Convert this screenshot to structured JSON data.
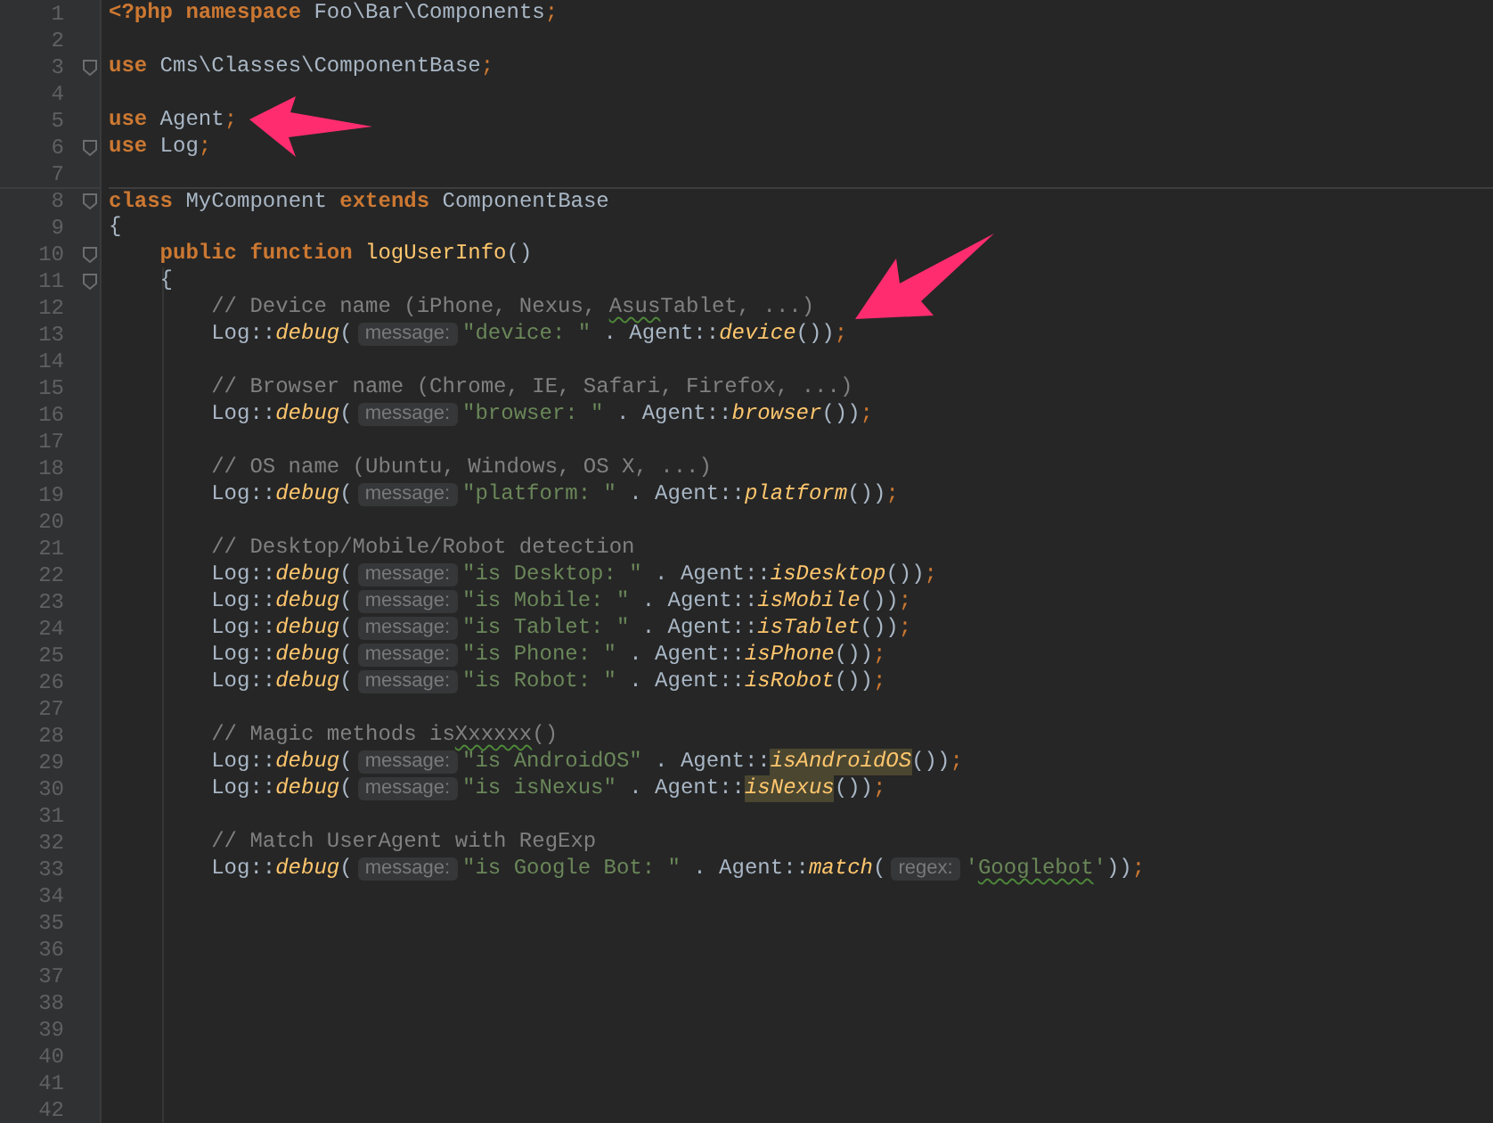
{
  "editor": {
    "lines": [
      {
        "number": "1",
        "fold": false,
        "kind": "top",
        "tokens": [
          {
            "kind": "keyword",
            "text": "<?php namespace"
          },
          {
            "kind": "plain",
            "text": " Foo\\Bar\\Components"
          },
          {
            "kind": "semicolon",
            "text": ";"
          }
        ]
      },
      {
        "number": "2",
        "fold": false,
        "kind": "blank"
      },
      {
        "number": "3",
        "fold": true,
        "kind": "top",
        "tokens": [
          {
            "kind": "keyword",
            "text": "use"
          },
          {
            "kind": "plain",
            "text": " Cms\\Classes\\ComponentBase"
          },
          {
            "kind": "semicolon",
            "text": ";"
          }
        ]
      },
      {
        "number": "4",
        "fold": false,
        "kind": "blank"
      },
      {
        "number": "5",
        "fold": false,
        "kind": "top",
        "tokens": [
          {
            "kind": "keyword",
            "text": "use"
          },
          {
            "kind": "plain",
            "text": " Agent"
          },
          {
            "kind": "semicolon",
            "text": ";"
          }
        ]
      },
      {
        "number": "6",
        "fold": true,
        "kind": "top",
        "tokens": [
          {
            "kind": "keyword",
            "text": "use"
          },
          {
            "kind": "plain",
            "text": " Log"
          },
          {
            "kind": "semicolon",
            "text": ";"
          }
        ]
      },
      {
        "number": "7",
        "fold": false,
        "kind": "blank"
      },
      {
        "number": "8",
        "fold": true,
        "divider": true,
        "kind": "top",
        "tokens": [
          {
            "kind": "keyword",
            "text": "class"
          },
          {
            "kind": "plain",
            "text": " MyComponent "
          },
          {
            "kind": "keyword",
            "text": "extends"
          },
          {
            "kind": "plain",
            "text": " ComponentBase"
          }
        ]
      },
      {
        "number": "9",
        "fold": false,
        "kind": "top",
        "tokens": [
          {
            "kind": "plain",
            "text": "{"
          }
        ]
      },
      {
        "number": "10",
        "fold": true,
        "kind": "member",
        "tokens": [
          {
            "kind": "keyword",
            "text": "public function"
          },
          {
            "kind": "declaration",
            "text": " logUserInfo"
          },
          {
            "kind": "plain",
            "text": "()"
          }
        ]
      },
      {
        "number": "11",
        "fold": true,
        "kind": "member",
        "tokens": [
          {
            "kind": "plain",
            "text": "{"
          }
        ]
      },
      {
        "number": "12",
        "fold": false,
        "kind": "statement",
        "tokens": [
          {
            "kind": "comment",
            "text": "// Device name (iPhone, Nexus, "
          },
          {
            "kind": "comment-typo",
            "text": "Asus"
          },
          {
            "kind": "comment",
            "text": "Tablet, ...)"
          }
        ]
      },
      {
        "number": "13",
        "fold": false,
        "kind": "statement",
        "tokens": [
          {
            "kind": "plain",
            "text": "Log::"
          },
          {
            "kind": "call",
            "text": "debug"
          },
          {
            "kind": "plain",
            "text": "("
          },
          {
            "kind": "hint",
            "text": "message:"
          },
          {
            "kind": "string",
            "text": "\"device: \""
          },
          {
            "kind": "plain",
            "text": " . Agent::"
          },
          {
            "kind": "call",
            "text": "device"
          },
          {
            "kind": "plain",
            "text": "())"
          },
          {
            "kind": "semicolon",
            "text": ";"
          }
        ]
      },
      {
        "number": "14",
        "fold": false,
        "kind": "blank"
      },
      {
        "number": "15",
        "fold": false,
        "kind": "statement",
        "tokens": [
          {
            "kind": "comment",
            "text": "// Browser name (Chrome, IE, Safari, Firefox, ...)"
          }
        ]
      },
      {
        "number": "16",
        "fold": false,
        "kind": "statement",
        "tokens": [
          {
            "kind": "plain",
            "text": "Log::"
          },
          {
            "kind": "call",
            "text": "debug"
          },
          {
            "kind": "plain",
            "text": "("
          },
          {
            "kind": "hint",
            "text": "message:"
          },
          {
            "kind": "string",
            "text": "\"browser: \""
          },
          {
            "kind": "plain",
            "text": " . Agent::"
          },
          {
            "kind": "call",
            "text": "browser"
          },
          {
            "kind": "plain",
            "text": "())"
          },
          {
            "kind": "semicolon",
            "text": ";"
          }
        ]
      },
      {
        "number": "17",
        "fold": false,
        "kind": "blank"
      },
      {
        "number": "18",
        "fold": false,
        "kind": "statement",
        "tokens": [
          {
            "kind": "comment",
            "text": "// OS name (Ubuntu, Windows, OS X, ...)"
          }
        ]
      },
      {
        "number": "19",
        "fold": false,
        "kind": "statement",
        "tokens": [
          {
            "kind": "plain",
            "text": "Log::"
          },
          {
            "kind": "call",
            "text": "debug"
          },
          {
            "kind": "plain",
            "text": "("
          },
          {
            "kind": "hint",
            "text": "message:"
          },
          {
            "kind": "string",
            "text": "\"platform: \""
          },
          {
            "kind": "plain",
            "text": " . Agent::"
          },
          {
            "kind": "call",
            "text": "platform"
          },
          {
            "kind": "plain",
            "text": "())"
          },
          {
            "kind": "semicolon",
            "text": ";"
          }
        ]
      },
      {
        "number": "20",
        "fold": false,
        "kind": "blank"
      },
      {
        "number": "21",
        "fold": false,
        "kind": "statement",
        "tokens": [
          {
            "kind": "comment",
            "text": "// Desktop/Mobile/Robot detection"
          }
        ]
      },
      {
        "number": "22",
        "fold": false,
        "kind": "statement",
        "tokens": [
          {
            "kind": "plain",
            "text": "Log::"
          },
          {
            "kind": "call",
            "text": "debug"
          },
          {
            "kind": "plain",
            "text": "("
          },
          {
            "kind": "hint",
            "text": "message:"
          },
          {
            "kind": "string",
            "text": "\"is Desktop: \""
          },
          {
            "kind": "plain",
            "text": " . Agent::"
          },
          {
            "kind": "call",
            "text": "isDesktop"
          },
          {
            "kind": "plain",
            "text": "())"
          },
          {
            "kind": "semicolon",
            "text": ";"
          }
        ]
      },
      {
        "number": "23",
        "fold": false,
        "kind": "statement",
        "tokens": [
          {
            "kind": "plain",
            "text": "Log::"
          },
          {
            "kind": "call",
            "text": "debug"
          },
          {
            "kind": "plain",
            "text": "("
          },
          {
            "kind": "hint",
            "text": "message:"
          },
          {
            "kind": "string",
            "text": "\"is Mobile: \""
          },
          {
            "kind": "plain",
            "text": " . Agent::"
          },
          {
            "kind": "call",
            "text": "isMobile"
          },
          {
            "kind": "plain",
            "text": "())"
          },
          {
            "kind": "semicolon",
            "text": ";"
          }
        ]
      },
      {
        "number": "24",
        "fold": false,
        "kind": "statement",
        "tokens": [
          {
            "kind": "plain",
            "text": "Log::"
          },
          {
            "kind": "call",
            "text": "debug"
          },
          {
            "kind": "plain",
            "text": "("
          },
          {
            "kind": "hint",
            "text": "message:"
          },
          {
            "kind": "string",
            "text": "\"is Tablet: \""
          },
          {
            "kind": "plain",
            "text": " . Agent::"
          },
          {
            "kind": "call",
            "text": "isTablet"
          },
          {
            "kind": "plain",
            "text": "())"
          },
          {
            "kind": "semicolon",
            "text": ";"
          }
        ]
      },
      {
        "number": "25",
        "fold": false,
        "kind": "statement",
        "tokens": [
          {
            "kind": "plain",
            "text": "Log::"
          },
          {
            "kind": "call",
            "text": "debug"
          },
          {
            "kind": "plain",
            "text": "("
          },
          {
            "kind": "hint",
            "text": "message:"
          },
          {
            "kind": "string",
            "text": "\"is Phone: \""
          },
          {
            "kind": "plain",
            "text": " . Agent::"
          },
          {
            "kind": "call",
            "text": "isPhone"
          },
          {
            "kind": "plain",
            "text": "())"
          },
          {
            "kind": "semicolon",
            "text": ";"
          }
        ]
      },
      {
        "number": "26",
        "fold": false,
        "kind": "statement",
        "tokens": [
          {
            "kind": "plain",
            "text": "Log::"
          },
          {
            "kind": "call",
            "text": "debug"
          },
          {
            "kind": "plain",
            "text": "("
          },
          {
            "kind": "hint",
            "text": "message:"
          },
          {
            "kind": "string",
            "text": "\"is Robot: \""
          },
          {
            "kind": "plain",
            "text": " . Agent::"
          },
          {
            "kind": "call",
            "text": "isRobot"
          },
          {
            "kind": "plain",
            "text": "())"
          },
          {
            "kind": "semicolon",
            "text": ";"
          }
        ]
      },
      {
        "number": "27",
        "fold": false,
        "kind": "blank"
      },
      {
        "number": "28",
        "fold": false,
        "kind": "statement",
        "tokens": [
          {
            "kind": "comment",
            "text": "// Magic methods is"
          },
          {
            "kind": "comment-typo",
            "text": "Xxxxxx"
          },
          {
            "kind": "comment",
            "text": "()"
          }
        ]
      },
      {
        "number": "29",
        "fold": false,
        "kind": "statement",
        "tokens": [
          {
            "kind": "plain",
            "text": "Log::"
          },
          {
            "kind": "call",
            "text": "debug"
          },
          {
            "kind": "plain",
            "text": "("
          },
          {
            "kind": "hint",
            "text": "message:"
          },
          {
            "kind": "string",
            "text": "\"is AndroidOS\""
          },
          {
            "kind": "plain",
            "text": " . Agent::"
          },
          {
            "kind": "call-highlight",
            "text": "isAndroidOS"
          },
          {
            "kind": "plain",
            "text": "())"
          },
          {
            "kind": "semicolon",
            "text": ";"
          }
        ]
      },
      {
        "number": "30",
        "fold": false,
        "kind": "statement",
        "tokens": [
          {
            "kind": "plain",
            "text": "Log::"
          },
          {
            "kind": "call",
            "text": "debug"
          },
          {
            "kind": "plain",
            "text": "("
          },
          {
            "kind": "hint",
            "text": "message:"
          },
          {
            "kind": "string",
            "text": "\"is isNexus\""
          },
          {
            "kind": "plain",
            "text": " . Agent::"
          },
          {
            "kind": "call-highlight",
            "text": "isNexus"
          },
          {
            "kind": "plain",
            "text": "())"
          },
          {
            "kind": "semicolon",
            "text": ";"
          }
        ]
      },
      {
        "number": "31",
        "fold": false,
        "kind": "blank"
      },
      {
        "number": "32",
        "fold": false,
        "kind": "statement",
        "tokens": [
          {
            "kind": "comment",
            "text": "// Match UserAgent with RegExp"
          }
        ]
      },
      {
        "number": "33",
        "fold": false,
        "kind": "statement",
        "tokens": [
          {
            "kind": "plain",
            "text": "Log::"
          },
          {
            "kind": "call",
            "text": "debug"
          },
          {
            "kind": "plain",
            "text": "("
          },
          {
            "kind": "hint",
            "text": "message:"
          },
          {
            "kind": "string",
            "text": "\"is Google Bot: \""
          },
          {
            "kind": "plain",
            "text": " . Agent::"
          },
          {
            "kind": "call",
            "text": "match"
          },
          {
            "kind": "plain",
            "text": "("
          },
          {
            "kind": "hint",
            "text": "regex:"
          },
          {
            "kind": "string",
            "text": "'"
          },
          {
            "kind": "string-typo",
            "text": "Googlebot"
          },
          {
            "kind": "string",
            "text": "'"
          },
          {
            "kind": "plain",
            "text": "))"
          },
          {
            "kind": "semicolon",
            "text": ";"
          }
        ]
      },
      {
        "number": "34",
        "fold": false,
        "kind": "blank"
      },
      {
        "number": "35",
        "fold": false,
        "kind": "blank"
      },
      {
        "number": "36",
        "fold": false,
        "kind": "blank"
      },
      {
        "number": "37",
        "fold": false,
        "kind": "blank"
      },
      {
        "number": "38",
        "fold": false,
        "kind": "blank"
      },
      {
        "number": "39",
        "fold": false,
        "kind": "blank"
      },
      {
        "number": "40",
        "fold": false,
        "kind": "blank"
      },
      {
        "number": "41",
        "fold": false,
        "kind": "blank"
      },
      {
        "number": "42",
        "fold": false,
        "kind": "blank"
      }
    ]
  }
}
